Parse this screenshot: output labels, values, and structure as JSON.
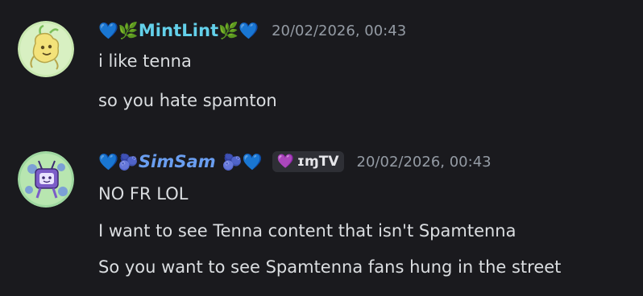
{
  "messages": [
    {
      "author": "MintLint",
      "author_prefix": "💙🌿",
      "author_suffix": "🌿💙",
      "timestamp": "20/02/2026, 00:43",
      "lines": [
        "i like tenna",
        "so you hate spamton"
      ]
    },
    {
      "author": "SimSam",
      "author_prefix": "💙🫐",
      "author_suffix": "🫐💙",
      "role_tag": "ɪɱTV",
      "timestamp": "20/02/2026, 00:43",
      "lines": [
        "NO FR LOL",
        "I want to see Tenna content that isn't Spamtenna",
        "So you want to see Spamtenna fans hung in the street"
      ]
    }
  ],
  "colors": {
    "background": "#1a1a1e",
    "text": "#dbdee1",
    "timestamp": "#949ba4",
    "mintlint_name": "#63d0ea",
    "simsam_name": "#6a9ef0"
  }
}
